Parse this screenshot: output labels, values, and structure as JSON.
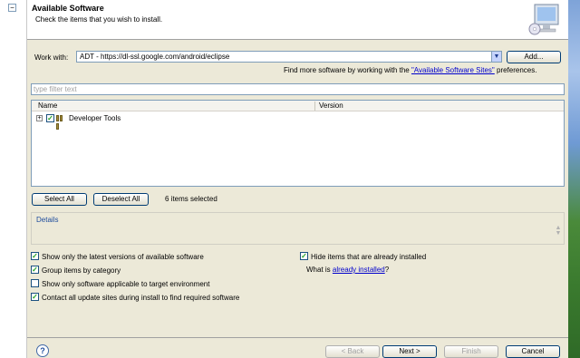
{
  "banner": {
    "title": "Available Software",
    "description": "Check the items that you wish to install."
  },
  "work_with": {
    "label": "Work with:",
    "value": "ADT - https://dl-ssl.google.com/android/eclipse",
    "add_label": "Add...",
    "more_prefix": "Find more software by working with the ",
    "more_link": "\"Available Software Sites\"",
    "more_suffix": " preferences."
  },
  "filter": {
    "placeholder": "type filter text"
  },
  "table": {
    "columns": [
      "Name",
      "Version"
    ],
    "rows": [
      {
        "name": "Developer Tools",
        "version": ""
      }
    ]
  },
  "selection": {
    "select_all": "Select All",
    "deselect_all": "Deselect All",
    "status": "6 items selected"
  },
  "details": {
    "label": "Details"
  },
  "options": {
    "latest": "Show only the latest versions of available software",
    "hide_installed": "Hide items that are already installed",
    "group": "Group items by category",
    "what_is_prefix": "What is ",
    "already_installed": "already installed",
    "what_is_suffix": "?",
    "applicable": "Show only software applicable to target environment",
    "contact": "Contact all update sites during install to find required software"
  },
  "buttons": {
    "back": "< Back",
    "next": "Next >",
    "finish": "Finish",
    "cancel": "Cancel"
  },
  "colors": {
    "link": "#0000cc",
    "check": "#21a121",
    "border": "#7f9db9"
  }
}
